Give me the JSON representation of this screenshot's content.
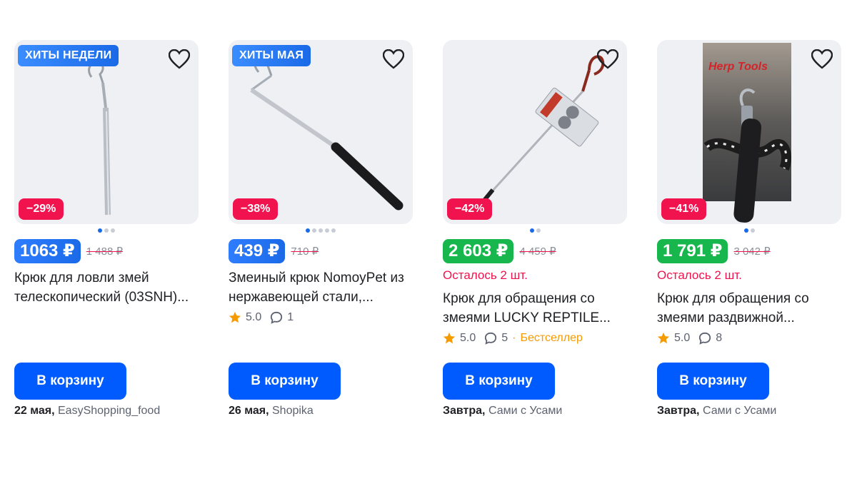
{
  "products": [
    {
      "hit_badge": "ХИТЫ НЕДЕЛИ",
      "discount": "−29%",
      "price": "1063 ₽",
      "old_price": "1 488 ₽",
      "title": "Крюк для ловли змей телескопический (03SNH)...",
      "cart_label": "В корзину",
      "delivery_date": "22 мая,",
      "seller": "EasyShopping_food",
      "dots": 3,
      "active_dot": 1
    },
    {
      "hit_badge": "ХИТЫ МАЯ",
      "discount": "−38%",
      "price": "439 ₽",
      "old_price": "710 ₽",
      "title": "Змеиный крюк NomoyPet из нержавеющей стали,...",
      "rating": "5.0",
      "reviews": "1",
      "cart_label": "В корзину",
      "delivery_date": "26 мая,",
      "seller": "Shopika",
      "dots": 5,
      "active_dot": 1
    },
    {
      "discount": "−42%",
      "price": "2 603 ₽",
      "old_price": "4 459 ₽",
      "stock": "Осталось 2 шт.",
      "title": "Крюк для обращения со змеями LUCKY REPTILE...",
      "rating": "5.0",
      "reviews": "5",
      "separator": "·",
      "bestseller": "Бестселлер",
      "cart_label": "В корзину",
      "delivery_date": "Завтра,",
      "seller": "Сами с Усами",
      "dots": 2,
      "active_dot": 1
    },
    {
      "discount": "−41%",
      "price": "1 791 ₽",
      "old_price": "3 042 ₽",
      "stock": "Осталось 2 шт.",
      "title": "Крюк для обращения со змеями раздвижной...",
      "rating": "5.0",
      "reviews": "8",
      "cart_label": "В корзину",
      "delivery_date": "Завтра,",
      "seller": "Сами с Усами",
      "package_text": "Herp Tools",
      "dots": 2,
      "active_dot": 1
    }
  ],
  "colors": {
    "accent_blue": "#005bff",
    "discount_red": "#f0134d",
    "price_green": "#17b74d",
    "star_orange": "#f59b00"
  }
}
